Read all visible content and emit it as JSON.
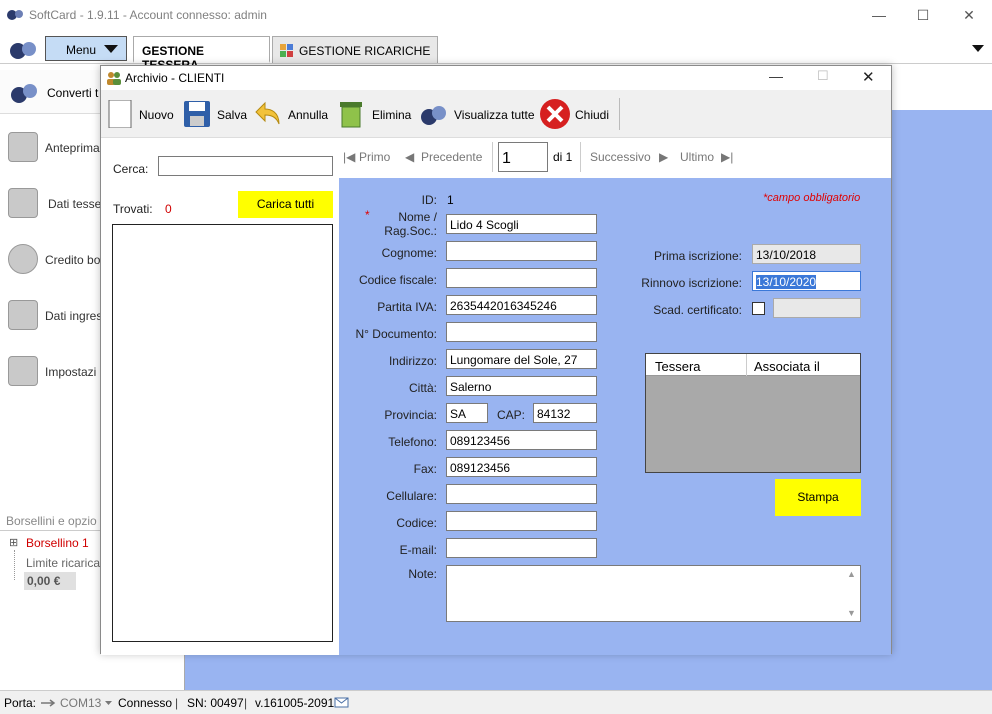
{
  "app": {
    "title": "SoftCard - 1.9.11 - Account connesso: admin",
    "menu_label": "Menu",
    "tabs": [
      {
        "label": "GESTIONE TESSERA",
        "active": true
      },
      {
        "label": "GESTIONE RICARICHE",
        "active": false
      }
    ]
  },
  "sidebar": {
    "top_label": "Converti t",
    "items": [
      {
        "label": "Anteprima"
      },
      {
        "label": "Dati tesse"
      },
      {
        "label": "Credito bo"
      },
      {
        "label": "Dati ingres"
      },
      {
        "label": "Impostazi"
      }
    ],
    "section_label": "Borsellini e opzio",
    "tree": {
      "expander": "⊞",
      "item": "Borsellino 1",
      "sub": "Limite ricarica",
      "value": "0,00 €"
    }
  },
  "dialog": {
    "title": "Archivio - CLIENTI",
    "toolbar": {
      "nuovo": "Nuovo",
      "salva": "Salva",
      "annulla": "Annulla",
      "elimina": "Elimina",
      "visualizza": "Visualizza tutte",
      "chiudi": "Chiudi"
    },
    "search": {
      "label": "Cerca:",
      "value": "",
      "found_label": "Trovati:",
      "found_count": "0",
      "load_all": "Carica tutti"
    },
    "nav": {
      "first": "Primo",
      "prev": "Precedente",
      "page": "1",
      "of": "di 1",
      "next": "Successivo",
      "last": "Ultimo"
    },
    "form": {
      "required_note": "*campo obbligatorio",
      "required_mark": "*",
      "id_label": "ID:",
      "id_value": "1",
      "nome_label": "Nome / Rag.Soc.:",
      "nome": "Lido 4 Scogli",
      "cognome_label": "Cognome:",
      "cognome": "",
      "cf_label": "Codice fiscale:",
      "cf": "",
      "piva_label": "Partita IVA:",
      "piva": "2635442016345246",
      "doc_label": "N° Documento:",
      "doc": "",
      "indirizzo_label": "Indirizzo:",
      "indirizzo": "Lungomare del Sole, 27",
      "citta_label": "Città:",
      "citta": "Salerno",
      "provincia_label": "Provincia:",
      "provincia": "SA",
      "cap_label": "CAP:",
      "cap": "84132",
      "telefono_label": "Telefono:",
      "telefono": "089123456",
      "fax_label": "Fax:",
      "fax": "089123456",
      "cellulare_label": "Cellulare:",
      "cellulare": "",
      "codice_label": "Codice:",
      "codice": "",
      "email_label": "E-mail:",
      "email": "",
      "note_label": "Note:",
      "note": "",
      "prima_label": "Prima iscrizione:",
      "prima": "13/10/2018",
      "rinnovo_label": "Rinnovo iscrizione:",
      "rinnovo": "13/10/2020",
      "scad_label": "Scad. certificato:",
      "scad": "",
      "table_col1": "Tessera",
      "table_col2": "Associata il",
      "stampa": "Stampa"
    }
  },
  "status": {
    "porta": "Porta:",
    "com": "COM13",
    "connesso": "Connesso",
    "sn": "SN: 00497",
    "version": "v.161005-2091"
  },
  "colors": {
    "form_bg": "#99b4f1",
    "yellow_button": "#ffff00",
    "required": "#e00000"
  }
}
